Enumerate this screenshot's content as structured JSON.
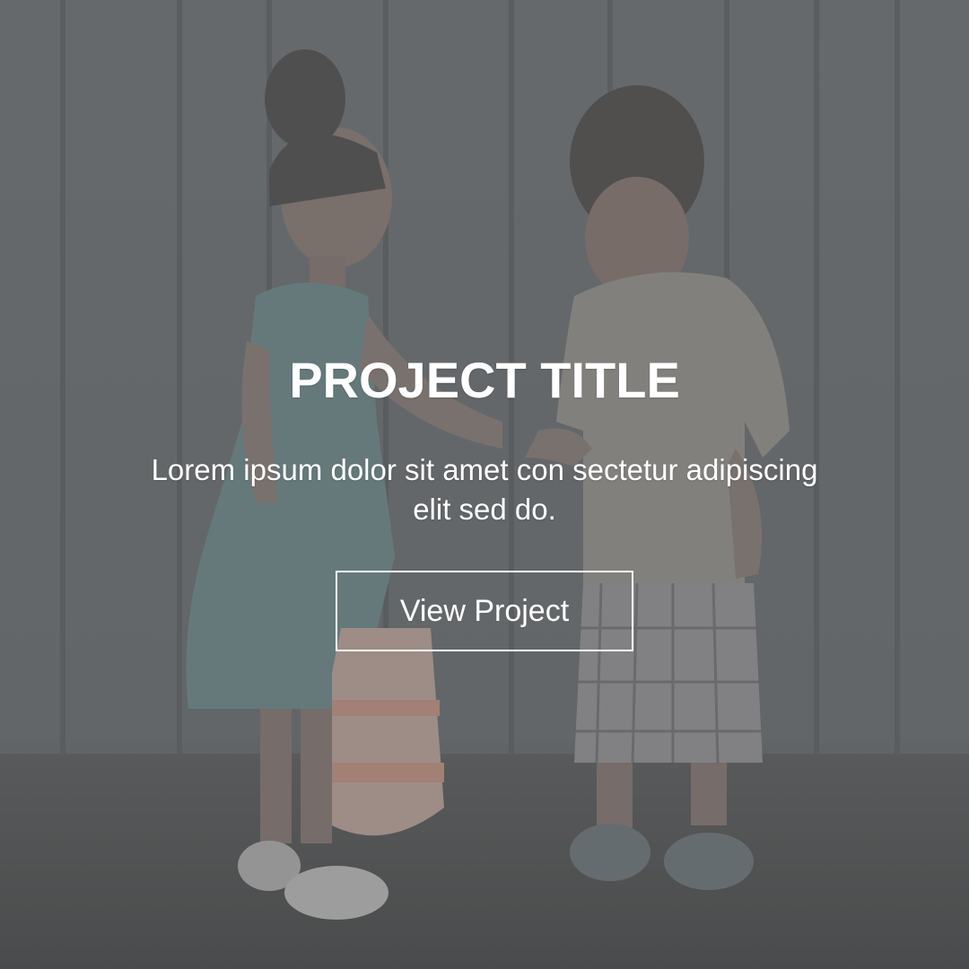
{
  "card": {
    "title": "PROJECT TITLE",
    "description": "Lorem ipsum dolor sit amet con sectetur adipiscing elit sed do.",
    "button_label": "View Project"
  },
  "background": {
    "subject": "two children exchanging a small object in front of a weathered wooden fence",
    "overlay_color": "#8c8c8c"
  }
}
